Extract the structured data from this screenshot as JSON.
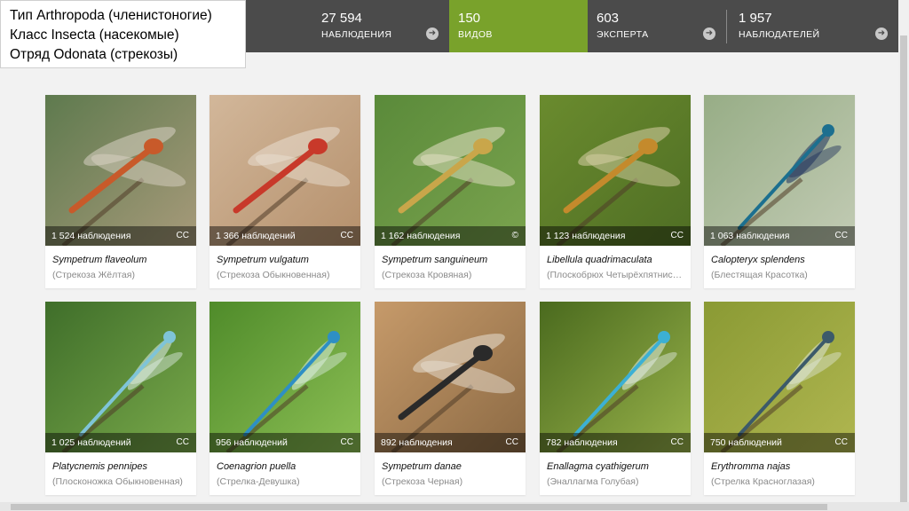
{
  "taxon": {
    "line1": "Тип Arthropoda (членистоногие)",
    "line2": "Класс Insecta (насекомые)",
    "line3": "Отряд Odonata (стрекозы)"
  },
  "stats": [
    {
      "value": "27 594",
      "label": "НАБЛЮДЕНИЯ",
      "active": false
    },
    {
      "value": "150",
      "label": "ВИДОВ",
      "active": true
    },
    {
      "value": "603",
      "label": "ЭКСПЕРТА",
      "active": false
    },
    {
      "value": "1 957",
      "label": "НАБЛЮДАТЕЛЕЙ",
      "active": false
    }
  ],
  "colors": {
    "accent": "#79a22b",
    "bar": "#4b4b4b"
  },
  "species": [
    {
      "count": "1 524 наблюдения",
      "license": "CC",
      "sci": "Sympetrum flaveolum",
      "common": "(Стрекоза Жёлтая)",
      "photo": {
        "bg1": "#5e7a4e",
        "bg2": "#a79a7a",
        "body": "#c85a2a",
        "wing": "#d9d2c4"
      }
    },
    {
      "count": "1 366 наблюдений",
      "license": "CC",
      "sci": "Sympetrum vulgatum",
      "common": "(Стрекоза Обыкновенная)",
      "photo": {
        "bg1": "#d2b79a",
        "bg2": "#b5906c",
        "body": "#c8392a",
        "wing": "#e9dfd2"
      }
    },
    {
      "count": "1 162 наблюдения",
      "license": "©",
      "sci": "Sympetrum sanguineum",
      "common": "(Стрекоза Кровяная)",
      "photo": {
        "bg1": "#5a8a3a",
        "bg2": "#7aa34e",
        "body": "#c9a64a",
        "wing": "#e6e2c8"
      }
    },
    {
      "count": "1 123 наблюдения",
      "license": "CC",
      "sci": "Libellula quadrimaculata",
      "common": "(Плоскобрюх Четырёхпятнистый)",
      "photo": {
        "bg1": "#6a8b2e",
        "bg2": "#4f6e24",
        "body": "#c48a2c",
        "wing": "#d8cfa6"
      }
    },
    {
      "count": "1 063 наблюдения",
      "license": "CC",
      "sci": "Calopteryx splendens",
      "common": "(Блестящая Красотка)",
      "photo": {
        "bg1": "#97ad86",
        "bg2": "#c2cbb4",
        "body": "#1c6f8f",
        "wing": "#1c2f5c"
      }
    },
    {
      "count": "1 025 наблюдений",
      "license": "CC",
      "sci": "Platycnemis pennipes",
      "common": "(Плосконожка Обыкновенная)",
      "photo": {
        "bg1": "#3f6e2a",
        "bg2": "#79a94a",
        "body": "#7fc4d8",
        "wing": "#e2efe8"
      }
    },
    {
      "count": "956 наблюдений",
      "license": "CC",
      "sci": "Coenagrion puella",
      "common": "(Стрелка-Девушка)",
      "photo": {
        "bg1": "#4f8b2a",
        "bg2": "#8cbf54",
        "body": "#2e8fc4",
        "wing": "#dceee0"
      }
    },
    {
      "count": "892 наблюдения",
      "license": "CC",
      "sci": "Sympetrum danae",
      "common": "(Стрекоза Черная)",
      "photo": {
        "bg1": "#c69a6a",
        "bg2": "#8c6a44",
        "body": "#2a2a2a",
        "wing": "#e8e0d4"
      }
    },
    {
      "count": "782 наблюдения",
      "license": "CC",
      "sci": "Enallagma cyathigerum",
      "common": "(Эналлагма Голубая)",
      "photo": {
        "bg1": "#4a6a1e",
        "bg2": "#98b24a",
        "body": "#3cb0d4",
        "wing": "#e2ece4"
      }
    },
    {
      "count": "750 наблюдений",
      "license": "CC",
      "sci": "Erythromma najas",
      "common": "(Стрелка Красноглазая)",
      "photo": {
        "bg1": "#8a9a34",
        "bg2": "#b0b650",
        "body": "#3c5a6a",
        "wing": "#dfe6d8"
      }
    }
  ]
}
